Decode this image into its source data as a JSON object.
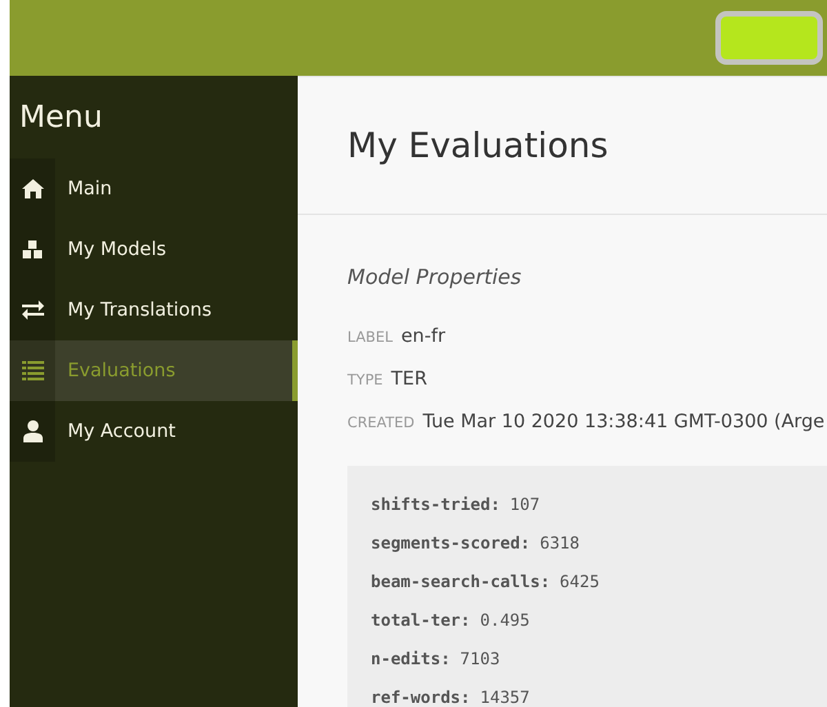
{
  "sidebar": {
    "title": "Menu",
    "items": [
      {
        "label": "Main",
        "selected": false
      },
      {
        "label": "My Models",
        "selected": false
      },
      {
        "label": "My Translations",
        "selected": false
      },
      {
        "label": "Evaluations",
        "selected": true
      },
      {
        "label": "My Account",
        "selected": false
      }
    ]
  },
  "page": {
    "title": "My Evaluations",
    "section": "Model Properties",
    "properties": [
      {
        "name": "LABEL",
        "value": "en-fr"
      },
      {
        "name": "TYPE",
        "value": "TER"
      },
      {
        "name": "CREATED",
        "value": "Tue Mar 10 2020 13:38:41 GMT-0300 (Arge"
      }
    ],
    "metrics": [
      {
        "key": "shifts-tried:",
        "value": "107"
      },
      {
        "key": "segments-scored:",
        "value": "6318"
      },
      {
        "key": "beam-search-calls:",
        "value": "6425"
      },
      {
        "key": "total-ter:",
        "value": "0.495"
      },
      {
        "key": "n-edits:",
        "value": "7103"
      },
      {
        "key": "ref-words:",
        "value": "14357"
      }
    ]
  }
}
